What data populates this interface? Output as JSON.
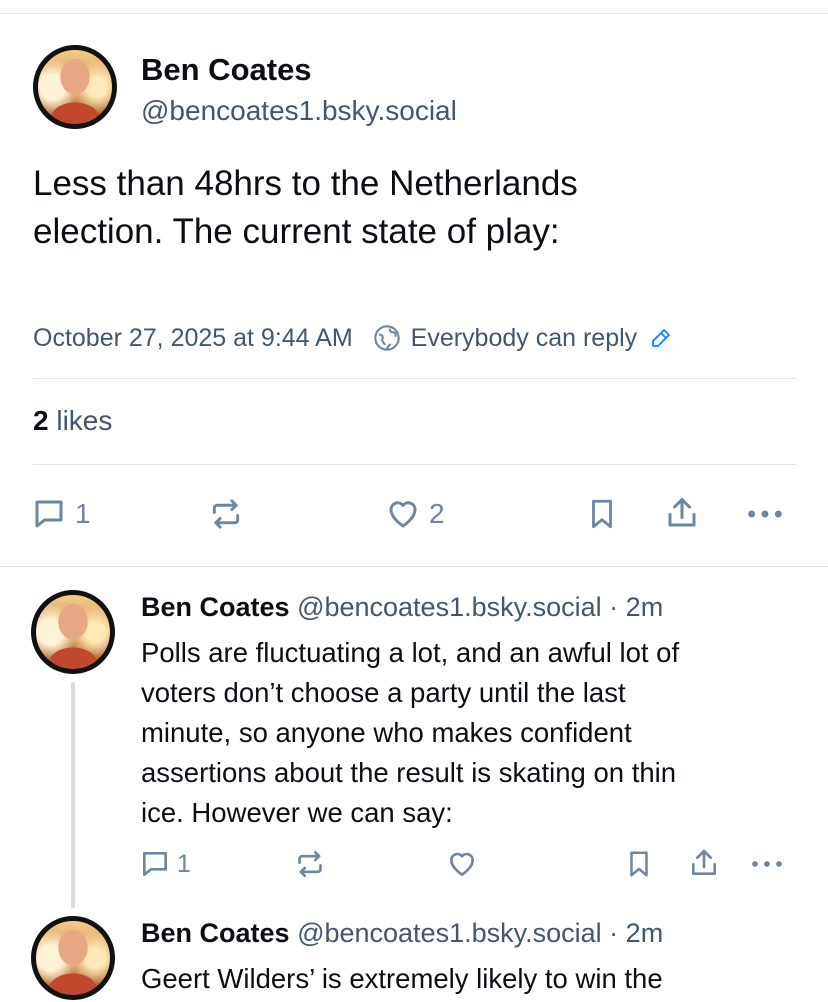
{
  "post": {
    "author_name": "Ben Coates",
    "author_handle": "@bencoates1.bsky.social",
    "text_line1": "Less than 48hrs to the Netherlands",
    "text_line2": "election. The current state of play:",
    "date": "October 27, 2025 at 9:44 AM",
    "reply_setting": "Everybody can reply",
    "likes_count": "2",
    "likes_label": "likes",
    "reply_count": "1",
    "like_count_action": "2"
  },
  "replies": [
    {
      "author_name": "Ben Coates",
      "author_handle": "@bencoates1.bsky.social",
      "separator": "·",
      "time": "2m",
      "lines": [
        "Polls are fluctuating a lot, and an awful lot of",
        "voters don’t choose a party until the last",
        "minute, so anyone who makes confident",
        "assertions about the result is skating on thin",
        "ice. However we can say:"
      ],
      "reply_count": "1"
    },
    {
      "author_name": "Ben Coates",
      "author_handle": "@bencoates1.bsky.social",
      "separator": "·",
      "time": "2m",
      "lines": [
        "Geert Wilders’  is extremely likely to win the"
      ]
    }
  ],
  "icons": {
    "reply": "speech-bubble-icon",
    "repost": "repost-arrows-icon",
    "like": "heart-icon",
    "bookmark": "bookmark-icon",
    "share": "share-upload-icon",
    "more": "more-dots-icon",
    "globe": "globe-icon",
    "edit": "pencil-icon"
  },
  "colors": {
    "text": "#0b0f14",
    "muted": "#42576c",
    "icon": "#6f869f",
    "accent": "#1083fe"
  }
}
